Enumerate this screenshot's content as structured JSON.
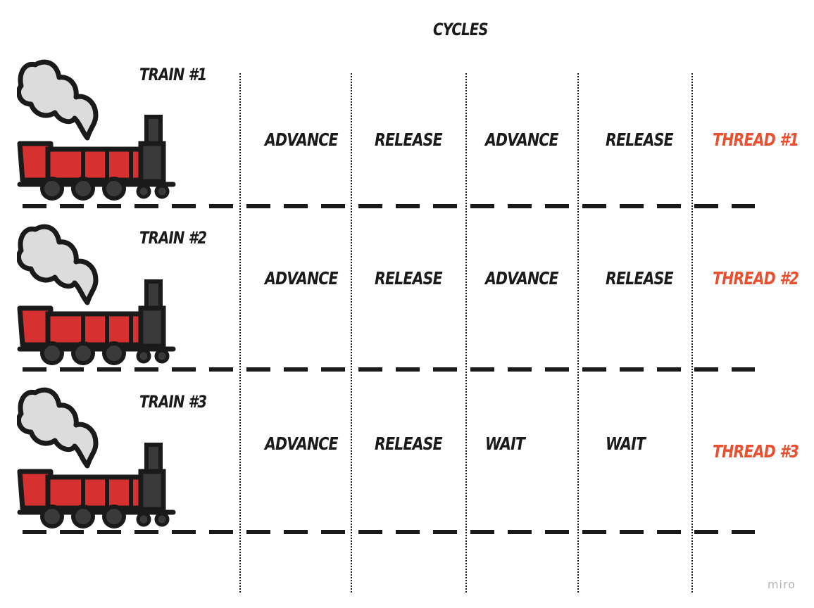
{
  "diagram": {
    "title": "CYCLES",
    "rows": [
      {
        "train": "TRAIN #1",
        "steps": [
          "ADVANCE",
          "RELEASE",
          "ADVANCE",
          "RELEASE"
        ],
        "thread": "THREAD #1"
      },
      {
        "train": "TRAIN #2",
        "steps": [
          "ADVANCE",
          "RELEASE",
          "ADVANCE",
          "RELEASE"
        ],
        "thread": "THREAD #2"
      },
      {
        "train": "TRAIN #3",
        "steps": [
          "ADVANCE",
          "RELEASE",
          "WAIT",
          "WAIT"
        ],
        "thread": "THREAD #3"
      }
    ],
    "colors": {
      "thread_label": "#e8502f",
      "train_body": "#d63031",
      "ink": "#1a1a1a",
      "smoke": "#dcdcdc"
    },
    "icons": [
      "steam-locomotive-icon"
    ]
  },
  "watermark": "miro"
}
